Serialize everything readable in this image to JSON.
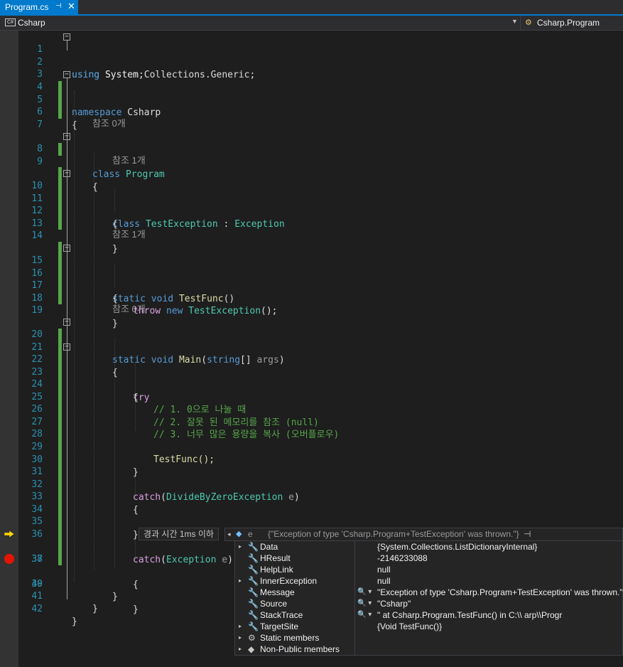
{
  "tab": {
    "title": "Program.cs",
    "pin_glyph": "⊣",
    "close_glyph": "✕"
  },
  "navbar": {
    "project": "Csharp",
    "project_icon": "C#",
    "member": "Csharp.Program"
  },
  "code": {
    "lines": [
      {
        "n": "1"
      },
      {
        "n": "2"
      },
      {
        "n": "3"
      },
      {
        "n": "4"
      },
      {
        "n": "5"
      },
      {
        "n": "6"
      },
      {
        "n": "7"
      },
      {
        "n": "8"
      },
      {
        "n": "9"
      },
      {
        "n": "10"
      },
      {
        "n": "11"
      },
      {
        "n": "12"
      },
      {
        "n": "13"
      },
      {
        "n": "14"
      },
      {
        "n": "15"
      },
      {
        "n": "16"
      },
      {
        "n": "17"
      },
      {
        "n": "18"
      },
      {
        "n": "19"
      },
      {
        "n": "20"
      },
      {
        "n": "21"
      },
      {
        "n": "22"
      },
      {
        "n": "23"
      },
      {
        "n": "24"
      },
      {
        "n": "25"
      },
      {
        "n": "26"
      },
      {
        "n": "27"
      },
      {
        "n": "28"
      },
      {
        "n": "29"
      },
      {
        "n": "30"
      },
      {
        "n": "31"
      },
      {
        "n": "32"
      },
      {
        "n": "33"
      },
      {
        "n": "34"
      },
      {
        "n": "35"
      },
      {
        "n": "36"
      },
      {
        "n": "37"
      },
      {
        "n": "38"
      },
      {
        "n": "39"
      },
      {
        "n": "40"
      },
      {
        "n": "41"
      },
      {
        "n": "42"
      }
    ],
    "t": {
      "using": "using",
      "system": "System;",
      "collections": "System.Collections.Generic;",
      "namespace": "namespace",
      "csharp": "Csharp",
      "lbrace": "{",
      "rbrace": "}",
      "class": "class",
      "program": "Program",
      "test_exception": "TestException",
      "colon": " : ",
      "exception": "Exception",
      "static": "static",
      "void": "void",
      "testfunc_decl": "TestFunc",
      "parens": "()",
      "throw": "throw",
      "new": "new",
      "ctor_end": "();",
      "main": "Main",
      "string": "string",
      "main_mid": "[] ",
      "args": "args",
      "rparen": ")",
      "try": "try",
      "comment1": "// 1. 0으로 나눌 때",
      "comment2": "// 2. 잘못 된 메모리를 참조 (null)",
      "comment3": "// 3. 너무 많은 용량을 복사 (오버플로우)",
      "call_testfunc": "TestFunc();",
      "catch": "catch",
      "lparen": "(",
      "divide_ex": "DivideByZeroException",
      "space": " ",
      "e": "e"
    },
    "lens": {
      "ref0": "참조 0개",
      "ref1": "참조 1개"
    },
    "elapsed": "경과 시간 1ms 이하"
  },
  "datatip": {
    "variable": "e",
    "summary": "{\"Exception of type 'Csharp.Program+TestException' was thrown.\"}",
    "pin_glyph": "⊣",
    "rows": [
      {
        "name": "Data",
        "value": "{System.Collections.ListDictionaryInternal}",
        "expand": "▸",
        "icon": "🔧",
        "mag": ""
      },
      {
        "name": "HResult",
        "value": "-2146233088",
        "expand": "",
        "icon": "🔧",
        "mag": ""
      },
      {
        "name": "HelpLink",
        "value": "null",
        "expand": "",
        "icon": "🔧",
        "mag": ""
      },
      {
        "name": "InnerException",
        "value": "null",
        "expand": "▸",
        "icon": "🔧",
        "mag": ""
      },
      {
        "name": "Message",
        "value": "\"Exception of type 'Csharp.Program+TestException' was thrown.\"",
        "expand": "",
        "icon": "🔧",
        "mag": "🔍 ▾"
      },
      {
        "name": "Source",
        "value": "\"Csharp\"",
        "expand": "",
        "icon": "🔧",
        "mag": "🔍 ▾"
      },
      {
        "name": "StackTrace",
        "value": "\"   at Csharp.Program.TestFunc() in C:\\\\                    arp\\\\Progr",
        "expand": "",
        "icon": "🔧",
        "mag": "🔍 ▾"
      },
      {
        "name": "TargetSite",
        "value": "{Void TestFunc()}",
        "expand": "▸",
        "icon": "🔧",
        "mag": ""
      },
      {
        "name": "Static members",
        "value": "",
        "expand": "▸",
        "icon": "⚙",
        "mag": ""
      },
      {
        "name": "Non-Public members",
        "value": "",
        "expand": "▸",
        "icon": "◆",
        "mag": ""
      }
    ]
  },
  "colors": {
    "accent": "#007acc",
    "keyword": "#569cd6",
    "type": "#4ec9b0",
    "control": "#d8a0df",
    "method": "#dcdcaa",
    "comment": "#57a64a",
    "line_number": "#2b91af",
    "breakpoint": "#e51400"
  }
}
